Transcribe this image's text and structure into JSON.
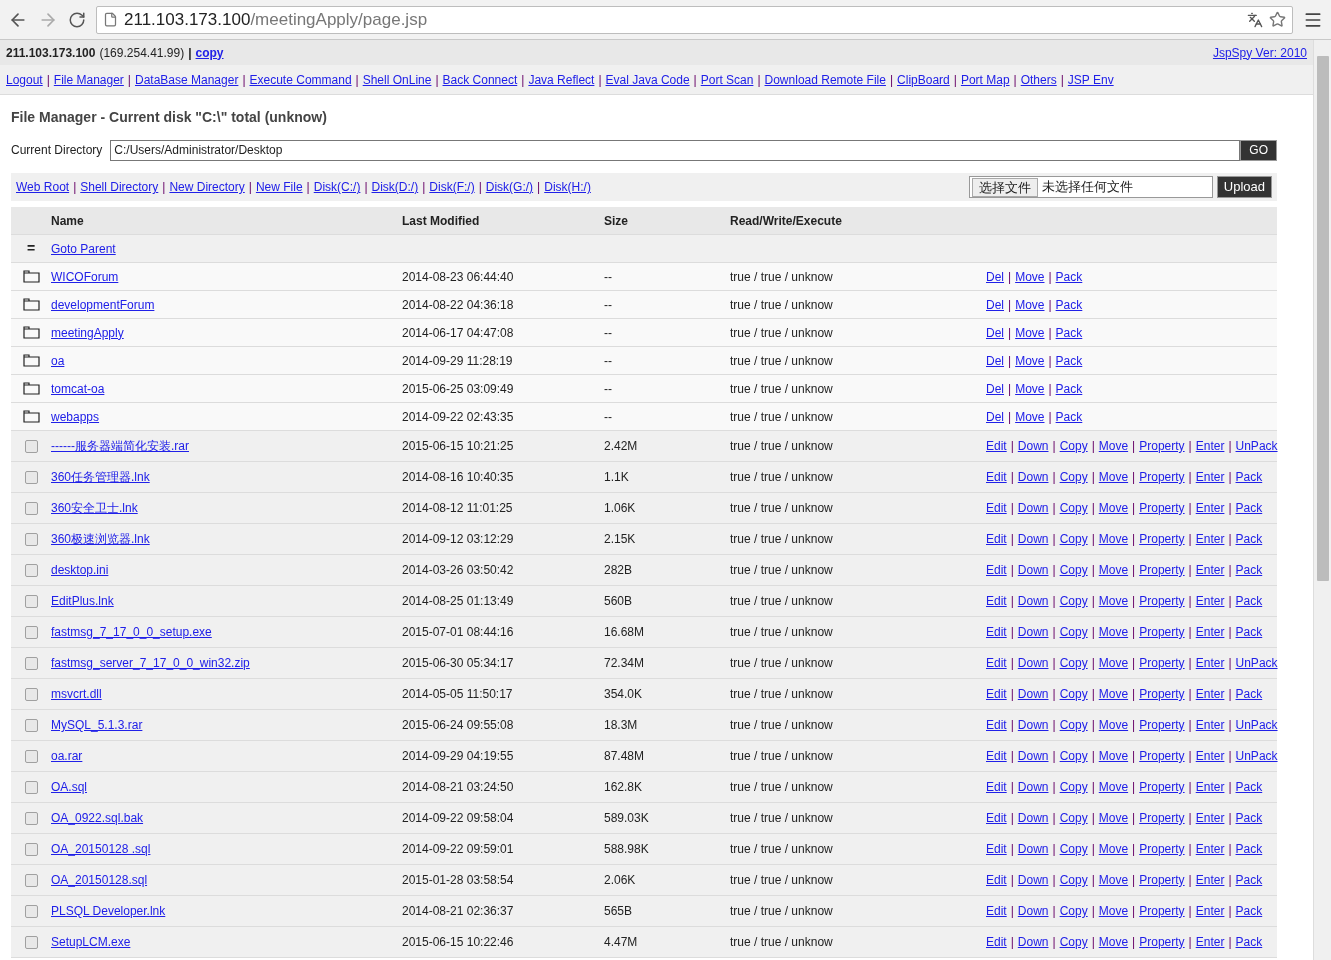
{
  "browser": {
    "url_host": "211.103.173.100",
    "url_path": "/meetingApply/page.jsp"
  },
  "info": {
    "host": "211.103.173.100",
    "ip": "(169.254.41.99)",
    "separator": "|",
    "copy_link": "copy",
    "version_link": "JspSpy Ver: 2010"
  },
  "nav": {
    "separator": "|",
    "links": [
      "Logout",
      "File Manager",
      "DataBase Manager",
      "Execute Command",
      "Shell OnLine",
      "Back Connect",
      "Java Reflect",
      "Eval Java Code",
      "Port Scan",
      "Download Remote File",
      "ClipBoard",
      "Port Map",
      "Others",
      "JSP Env"
    ]
  },
  "title": "File Manager - Current disk \"C:\\\" total (unknow)",
  "directory": {
    "label": "Current Directory",
    "value": "C:/Users/Administrator/Desktop",
    "button": "GO"
  },
  "quick_links": {
    "separator": "|",
    "links": [
      "Web Root",
      "Shell Directory",
      "New Directory",
      "New File",
      "Disk(C:/)",
      "Disk(D:/)",
      "Disk(F:/)",
      "Disk(G:/)",
      "Disk(H:/)"
    ]
  },
  "upload": {
    "choose_button": "选择文件",
    "status": "未选择任何文件",
    "button": "Upload"
  },
  "table": {
    "columns": [
      "Name",
      "Last Modified",
      "Size",
      "Read/Write/Execute"
    ],
    "parent": {
      "marker": "=",
      "link": "Goto Parent"
    },
    "action_separator": "|",
    "rows": [
      {
        "kind": "folder",
        "name": "WICOForum",
        "modified": "2014-08-23 06:44:40",
        "size": "--",
        "permissions": "true / true / unknow",
        "actions": [
          "Del",
          "Move",
          "Pack"
        ]
      },
      {
        "kind": "folder",
        "name": "developmentForum",
        "modified": "2014-08-22 04:36:18",
        "size": "--",
        "permissions": "true / true / unknow",
        "actions": [
          "Del",
          "Move",
          "Pack"
        ]
      },
      {
        "kind": "folder",
        "name": "meetingApply",
        "modified": "2014-06-17 04:47:08",
        "size": "--",
        "permissions": "true / true / unknow",
        "actions": [
          "Del",
          "Move",
          "Pack"
        ]
      },
      {
        "kind": "folder",
        "name": "oa",
        "modified": "2014-09-29 11:28:19",
        "size": "--",
        "permissions": "true / true / unknow",
        "actions": [
          "Del",
          "Move",
          "Pack"
        ]
      },
      {
        "kind": "folder",
        "name": "tomcat-oa",
        "modified": "2015-06-25 03:09:49",
        "size": "--",
        "permissions": "true / true / unknow",
        "actions": [
          "Del",
          "Move",
          "Pack"
        ]
      },
      {
        "kind": "folder",
        "name": "webapps",
        "modified": "2014-09-22 02:43:35",
        "size": "--",
        "permissions": "true / true / unknow",
        "actions": [
          "Del",
          "Move",
          "Pack"
        ]
      },
      {
        "kind": "file",
        "checked": false,
        "name": "------服务器端简化安装.rar",
        "modified": "2015-06-15 10:21:25",
        "size": "2.42M",
        "permissions": "true / true / unknow",
        "actions": [
          "Edit",
          "Down",
          "Copy",
          "Move",
          "Property",
          "Enter",
          "UnPack"
        ]
      },
      {
        "kind": "file",
        "checked": false,
        "name": "360任务管理器.lnk",
        "modified": "2014-08-16 10:40:35",
        "size": "1.1K",
        "permissions": "true / true / unknow",
        "actions": [
          "Edit",
          "Down",
          "Copy",
          "Move",
          "Property",
          "Enter",
          "Pack"
        ]
      },
      {
        "kind": "file",
        "checked": false,
        "name": "360安全卫士.lnk",
        "modified": "2014-08-12 11:01:25",
        "size": "1.06K",
        "permissions": "true / true / unknow",
        "actions": [
          "Edit",
          "Down",
          "Copy",
          "Move",
          "Property",
          "Enter",
          "Pack"
        ]
      },
      {
        "kind": "file",
        "checked": false,
        "name": "360极速浏览器.lnk",
        "modified": "2014-09-12 03:12:29",
        "size": "2.15K",
        "permissions": "true / true / unknow",
        "actions": [
          "Edit",
          "Down",
          "Copy",
          "Move",
          "Property",
          "Enter",
          "Pack"
        ]
      },
      {
        "kind": "file",
        "checked": false,
        "name": "desktop.ini",
        "modified": "2014-03-26 03:50:42",
        "size": "282B",
        "permissions": "true / true / unknow",
        "actions": [
          "Edit",
          "Down",
          "Copy",
          "Move",
          "Property",
          "Enter",
          "Pack"
        ]
      },
      {
        "kind": "file",
        "checked": false,
        "name": "EditPlus.lnk",
        "modified": "2014-08-25 01:13:49",
        "size": "560B",
        "permissions": "true / true / unknow",
        "actions": [
          "Edit",
          "Down",
          "Copy",
          "Move",
          "Property",
          "Enter",
          "Pack"
        ]
      },
      {
        "kind": "file",
        "checked": false,
        "name": "fastmsg_7_17_0_0_setup.exe",
        "modified": "2015-07-01 08:44:16",
        "size": "16.68M",
        "permissions": "true / true / unknow",
        "actions": [
          "Edit",
          "Down",
          "Copy",
          "Move",
          "Property",
          "Enter",
          "Pack"
        ]
      },
      {
        "kind": "file",
        "checked": false,
        "name": "fastmsg_server_7_17_0_0_win32.zip",
        "modified": "2015-06-30 05:34:17",
        "size": "72.34M",
        "permissions": "true / true / unknow",
        "actions": [
          "Edit",
          "Down",
          "Copy",
          "Move",
          "Property",
          "Enter",
          "UnPack"
        ]
      },
      {
        "kind": "file",
        "checked": false,
        "name": "msvcrt.dll",
        "modified": "2014-05-05 11:50:17",
        "size": "354.0K",
        "permissions": "true / true / unknow",
        "actions": [
          "Edit",
          "Down",
          "Copy",
          "Move",
          "Property",
          "Enter",
          "Pack"
        ]
      },
      {
        "kind": "file",
        "checked": false,
        "name": "MySQL_5.1.3.rar",
        "modified": "2015-06-24 09:55:08",
        "size": "18.3M",
        "permissions": "true / true / unknow",
        "actions": [
          "Edit",
          "Down",
          "Copy",
          "Move",
          "Property",
          "Enter",
          "UnPack"
        ]
      },
      {
        "kind": "file",
        "checked": false,
        "name": "oa.rar",
        "modified": "2014-09-29 04:19:55",
        "size": "87.48M",
        "permissions": "true / true / unknow",
        "actions": [
          "Edit",
          "Down",
          "Copy",
          "Move",
          "Property",
          "Enter",
          "UnPack"
        ]
      },
      {
        "kind": "file",
        "checked": false,
        "name": "OA.sql",
        "modified": "2014-08-21 03:24:50",
        "size": "162.8K",
        "permissions": "true / true / unknow",
        "actions": [
          "Edit",
          "Down",
          "Copy",
          "Move",
          "Property",
          "Enter",
          "Pack"
        ]
      },
      {
        "kind": "file",
        "checked": false,
        "name": "OA_0922.sql.bak",
        "modified": "2014-09-22 09:58:04",
        "size": "589.03K",
        "permissions": "true / true / unknow",
        "actions": [
          "Edit",
          "Down",
          "Copy",
          "Move",
          "Property",
          "Enter",
          "Pack"
        ]
      },
      {
        "kind": "file",
        "checked": false,
        "name": "OA_20150128 .sql",
        "modified": "2014-09-22 09:59:01",
        "size": "588.98K",
        "permissions": "true / true / unknow",
        "actions": [
          "Edit",
          "Down",
          "Copy",
          "Move",
          "Property",
          "Enter",
          "Pack"
        ]
      },
      {
        "kind": "file",
        "checked": false,
        "name": "OA_20150128.sql",
        "modified": "2015-01-28 03:58:54",
        "size": "2.06K",
        "permissions": "true / true / unknow",
        "actions": [
          "Edit",
          "Down",
          "Copy",
          "Move",
          "Property",
          "Enter",
          "Pack"
        ]
      },
      {
        "kind": "file",
        "checked": false,
        "name": "PLSQL Developer.lnk",
        "modified": "2014-08-21 02:36:37",
        "size": "565B",
        "permissions": "true / true / unknow",
        "actions": [
          "Edit",
          "Down",
          "Copy",
          "Move",
          "Property",
          "Enter",
          "Pack"
        ]
      },
      {
        "kind": "file",
        "checked": false,
        "name": "SetupLCM.exe",
        "modified": "2015-06-15 10:22:46",
        "size": "4.47M",
        "permissions": "true / true / unknow",
        "actions": [
          "Edit",
          "Down",
          "Copy",
          "Move",
          "Property",
          "Enter",
          "Pack"
        ]
      }
    ]
  }
}
